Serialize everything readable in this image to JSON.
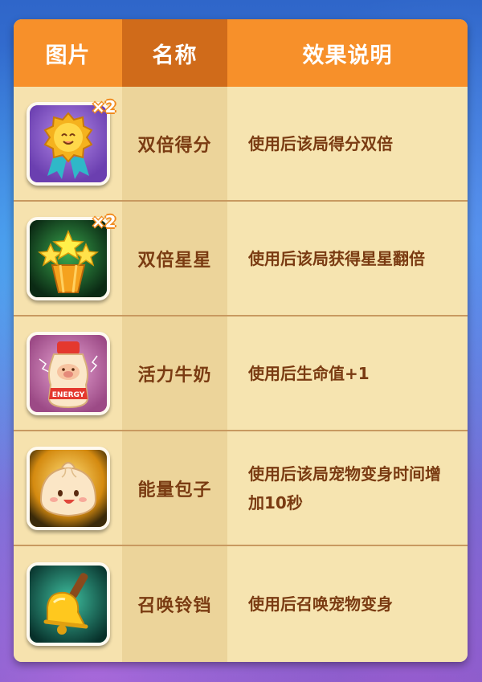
{
  "table": {
    "headers": {
      "image": "图片",
      "name": "名称",
      "effect": "效果说明"
    },
    "rows": [
      {
        "name": "双倍得分",
        "effect": "使用后该局得分双倍",
        "icon": "double-score-medal-icon",
        "badge": "×2",
        "bg": "#8b5fc9"
      },
      {
        "name": "双倍星星",
        "effect": "使用后该局获得星星翻倍",
        "icon": "double-stars-icon",
        "badge": "×2",
        "bg": "#1d5a2e"
      },
      {
        "name": "活力牛奶",
        "effect": "使用后生命值+1",
        "icon": "energy-milk-bottle-icon",
        "label": "ENERGY",
        "bg": "#c76aa8"
      },
      {
        "name": "能量包子",
        "effect": "使用后该局宠物变身时间增加10秒",
        "icon": "energy-bun-icon",
        "bg": "#e0a31a"
      },
      {
        "name": "召唤铃铛",
        "effect": "使用后召唤宠物变身",
        "icon": "summon-bell-icon",
        "bg": "#156a5a"
      }
    ]
  },
  "colors": {
    "header_orange": "#f7902a",
    "header_dark": "#d06b1a",
    "text_brown": "#7a3b12",
    "cell_bg": "#f6e4b0"
  }
}
